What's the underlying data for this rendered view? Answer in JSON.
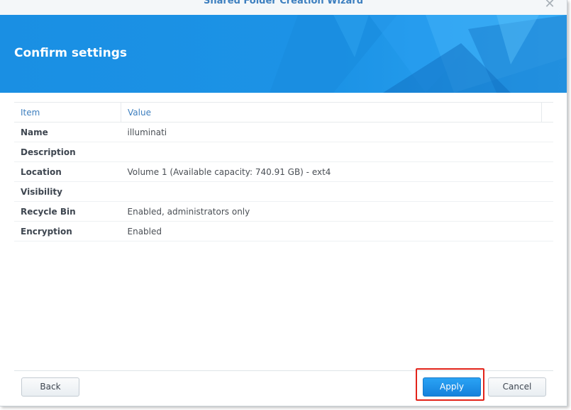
{
  "window": {
    "title": "Shared Folder Creation Wizard",
    "close_symbol": "✕"
  },
  "banner": {
    "title": "Confirm settings"
  },
  "table": {
    "headers": [
      "Item",
      "Value"
    ],
    "rows": [
      {
        "item": "Name",
        "value": "illuminati"
      },
      {
        "item": "Description",
        "value": ""
      },
      {
        "item": "Location",
        "value": "Volume 1 (Available capacity: 740.91 GB) - ext4"
      },
      {
        "item": "Visibility",
        "value": ""
      },
      {
        "item": "Recycle Bin",
        "value": "Enabled, administrators only"
      },
      {
        "item": "Encryption",
        "value": "Enabled"
      }
    ]
  },
  "footer": {
    "back_label": "Back",
    "apply_label": "Apply",
    "cancel_label": "Cancel"
  },
  "colors": {
    "accent": "#1a8fe3",
    "header_text": "#3d7fbf",
    "highlight": "#e2231a"
  },
  "icons": {
    "close": "close-icon"
  }
}
